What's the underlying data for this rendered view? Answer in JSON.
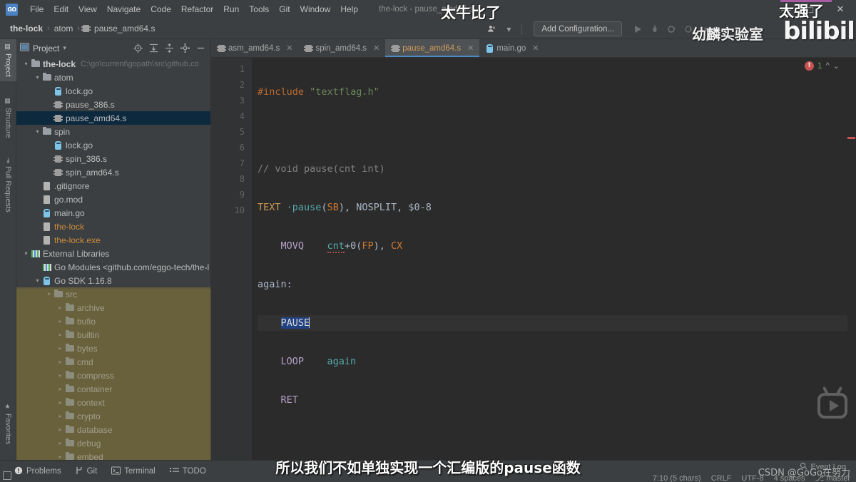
{
  "window": {
    "title": "the-lock - pause_amd64.s",
    "logo_text": "GO",
    "minimize": "—",
    "maximize": "□",
    "close": "✕"
  },
  "menu": {
    "items": [
      "File",
      "Edit",
      "View",
      "Navigate",
      "Code",
      "Refactor",
      "Run",
      "Tools",
      "Git",
      "Window",
      "Help"
    ]
  },
  "breadcrumb": {
    "items": [
      "the-lock",
      "atom",
      "pause_amd64.s"
    ],
    "separator": "›"
  },
  "run_toolbar": {
    "user_icon": "user-icon",
    "dropdown_caret": "▾",
    "add_configuration": "Add Configuration...",
    "run": "▶",
    "debug": "debug-icon",
    "coverage": "coverage-icon",
    "profile": "profile-icon",
    "more": "▾"
  },
  "tool_strip": {
    "top": [
      {
        "label": "Project",
        "icon": "project-icon",
        "active": true
      },
      {
        "label": "Structure",
        "icon": "structure-icon",
        "active": false
      },
      {
        "label": "Pull Requests",
        "icon": "pull-request-icon",
        "active": false
      }
    ],
    "bottom": [
      {
        "label": "Favorites",
        "icon": "star-icon",
        "active": false
      }
    ]
  },
  "project_panel": {
    "title": "Project",
    "title_caret": "▾",
    "icons": [
      "locate-icon",
      "expand-all-icon",
      "collapse-all-icon",
      "settings-icon",
      "hide-icon"
    ],
    "tree": [
      {
        "depth": 0,
        "arrow": "v",
        "icon": "folder",
        "label": "the-lock",
        "bold": true,
        "path": "C:\\go\\current\\gopath\\src\\github.co",
        "selected": false,
        "olive": false
      },
      {
        "depth": 1,
        "arrow": "v",
        "icon": "folder",
        "label": "atom",
        "bold": false,
        "selected": false,
        "olive": false
      },
      {
        "depth": 2,
        "arrow": "",
        "icon": "gofile",
        "label": "lock.go",
        "selected": false,
        "olive": false
      },
      {
        "depth": 2,
        "arrow": "",
        "icon": "asmfile",
        "label": "pause_386.s",
        "selected": false,
        "olive": false
      },
      {
        "depth": 2,
        "arrow": "",
        "icon": "asmfile",
        "label": "pause_amd64.s",
        "selected": true,
        "olive": false
      },
      {
        "depth": 1,
        "arrow": "v",
        "icon": "folder",
        "label": "spin",
        "selected": false,
        "olive": false
      },
      {
        "depth": 2,
        "arrow": "",
        "icon": "gofile",
        "label": "lock.go",
        "selected": false,
        "olive": false
      },
      {
        "depth": 2,
        "arrow": "",
        "icon": "asmfile",
        "label": "spin_386.s",
        "selected": false,
        "olive": false
      },
      {
        "depth": 2,
        "arrow": "",
        "icon": "asmfile",
        "label": "spin_amd64.s",
        "selected": false,
        "olive": false
      },
      {
        "depth": 1,
        "arrow": "",
        "icon": "docfile",
        "label": ".gitignore",
        "selected": false,
        "olive": false
      },
      {
        "depth": 1,
        "arrow": "",
        "icon": "docfile",
        "label": "go.mod",
        "selected": false,
        "olive": false
      },
      {
        "depth": 1,
        "arrow": "",
        "icon": "gofile",
        "label": "main.go",
        "selected": false,
        "olive": false
      },
      {
        "depth": 1,
        "arrow": "",
        "icon": "docfile",
        "label": "the-lock",
        "orange": true,
        "selected": false,
        "olive": false
      },
      {
        "depth": 1,
        "arrow": "",
        "icon": "docfile",
        "label": "the-lock.exe",
        "orange": true,
        "selected": false,
        "olive": false
      },
      {
        "depth": 0,
        "arrow": "v",
        "icon": "libico",
        "label": "External Libraries",
        "selected": false,
        "olive": false
      },
      {
        "depth": 1,
        "arrow": "",
        "icon": "libico",
        "label": "Go Modules <github.com/eggo-tech/the-l",
        "selected": false,
        "olive": false
      },
      {
        "depth": 1,
        "arrow": "v",
        "icon": "gofile",
        "label": "Go SDK 1.16.8",
        "selected": false,
        "olive": false
      },
      {
        "depth": 2,
        "arrow": "v",
        "icon": "folder",
        "label": "src",
        "selected": false,
        "olive": true
      },
      {
        "depth": 3,
        "arrow": ">",
        "icon": "folder",
        "label": "archive",
        "selected": false,
        "olive": true
      },
      {
        "depth": 3,
        "arrow": ">",
        "icon": "folder",
        "label": "bufio",
        "selected": false,
        "olive": true
      },
      {
        "depth": 3,
        "arrow": ">",
        "icon": "folder",
        "label": "builtin",
        "selected": false,
        "olive": true
      },
      {
        "depth": 3,
        "arrow": ">",
        "icon": "folder",
        "label": "bytes",
        "selected": false,
        "olive": true
      },
      {
        "depth": 3,
        "arrow": ">",
        "icon": "folder",
        "label": "cmd",
        "selected": false,
        "olive": true
      },
      {
        "depth": 3,
        "arrow": ">",
        "icon": "folder",
        "label": "compress",
        "selected": false,
        "olive": true
      },
      {
        "depth": 3,
        "arrow": ">",
        "icon": "folder",
        "label": "container",
        "selected": false,
        "olive": true
      },
      {
        "depth": 3,
        "arrow": ">",
        "icon": "folder",
        "label": "context",
        "selected": false,
        "olive": true
      },
      {
        "depth": 3,
        "arrow": ">",
        "icon": "folder",
        "label": "crypto",
        "selected": false,
        "olive": true
      },
      {
        "depth": 3,
        "arrow": ">",
        "icon": "folder",
        "label": "database",
        "selected": false,
        "olive": true
      },
      {
        "depth": 3,
        "arrow": ">",
        "icon": "folder",
        "label": "debug",
        "selected": false,
        "olive": true
      },
      {
        "depth": 3,
        "arrow": ">",
        "icon": "folder",
        "label": "embed",
        "selected": false,
        "olive": true
      }
    ]
  },
  "editor": {
    "tabs": [
      {
        "label": "asm_amd64.s",
        "icon": "asm-file-icon",
        "active": false,
        "close": "✕"
      },
      {
        "label": "spin_amd64.s",
        "icon": "asm-file-icon",
        "active": false,
        "close": "✕"
      },
      {
        "label": "pause_amd64.s",
        "icon": "asm-file-icon",
        "active": true,
        "close": "✕"
      },
      {
        "label": "main.go",
        "icon": "go-file-icon",
        "active": false,
        "close": "✕"
      }
    ],
    "line_numbers": [
      "1",
      "2",
      "3",
      "4",
      "5",
      "6",
      "7",
      "8",
      "9",
      "10"
    ],
    "lines": [
      "#include \"textflag.h\"",
      "",
      "// void pause(cnt int)",
      "TEXT ·pause(SB), NOSPLIT, $0-8",
      "    MOVQ    cnt+0(FP), CX",
      "again:",
      "    PAUSE",
      "    LOOP    again",
      "    RET",
      ""
    ],
    "selected_text": "PAUSE",
    "inspections": {
      "error_icon": "error-icon",
      "count": "1",
      "prev": "^",
      "next": "v"
    }
  },
  "status_bar": {
    "left_items": [
      {
        "label": "Problems",
        "icon": "problems-icon"
      },
      {
        "label": "Git",
        "icon": "git-icon"
      },
      {
        "label": "Terminal",
        "icon": "terminal-icon"
      },
      {
        "label": "TODO",
        "icon": "todo-icon"
      }
    ],
    "right_items": [
      "7:10 (5 chars)",
      "CRLF",
      "UTF-8",
      "4 spaces",
      "master"
    ],
    "event_log": "Event Log",
    "event_log_icon": "search-icon",
    "branch_icon": "branch-icon"
  },
  "overlays": {
    "danmaku_1": "太牛比了",
    "danmaku_2": "太强了",
    "watermark_lab": "幼麟实验室",
    "watermark_bili": "bilibili",
    "watermark_play": "bili-tv-play-icon",
    "subtitle": "所以我们不如单独实现一个汇编版的pause函数",
    "csdn": "CSDN @GoGo在努力"
  },
  "colors": {
    "panel_bg": "#3c3f41",
    "editor_bg": "#2b2b2b",
    "selection": "#214283",
    "tab_active_text": "#d09b5e",
    "tab_underline": "#4a88c7",
    "tree_selected": "#0d293e",
    "error_red": "#c75450",
    "count_green": "#6a9e52"
  }
}
